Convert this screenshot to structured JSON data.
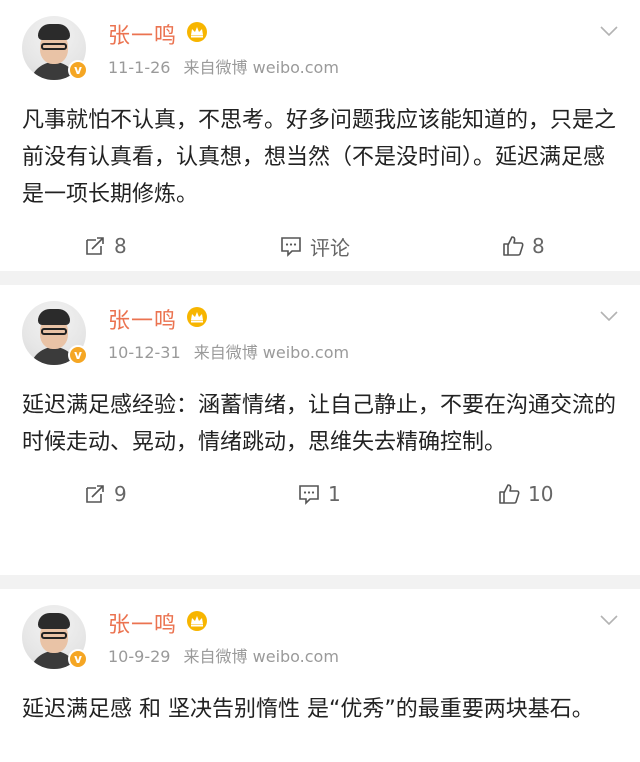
{
  "posts": [
    {
      "author": "张一鸣",
      "date": "11-1-26",
      "source": "来自微博 weibo.com",
      "text": "凡事就怕不认真，不思考。好多问题我应该能知道的，只是之前没有认真看，认真想，想当然（不是没时间）。延迟满足感是一项长期修炼。",
      "reposts": "8",
      "comments": "评论",
      "likes": "8"
    },
    {
      "author": "张一鸣",
      "date": "10-12-31",
      "source": "来自微博 weibo.com",
      "text": "延迟满足感经验：涵蓄情绪，让自己静止，不要在沟通交流的时候走动、晃动，情绪跳动，思维失去精确控制。",
      "reposts": "9",
      "comments": "1",
      "likes": "10"
    },
    {
      "author": "张一鸣",
      "date": "10-9-29",
      "source": "来自微博 weibo.com",
      "text": "延迟满足感 和 坚决告别惰性 是“优秀”的最重要两块基石。"
    }
  ],
  "icons": {
    "verified": "verified-badge-icon",
    "crown": "crown-icon",
    "menu": "chevron-down-icon",
    "repost": "repost-icon",
    "comment": "comment-icon",
    "like": "thumbs-up-icon"
  },
  "colors": {
    "name": "#eb7350",
    "badge": "#f5a623",
    "meta": "#9a9a9a",
    "background": "#f2f2f2"
  }
}
